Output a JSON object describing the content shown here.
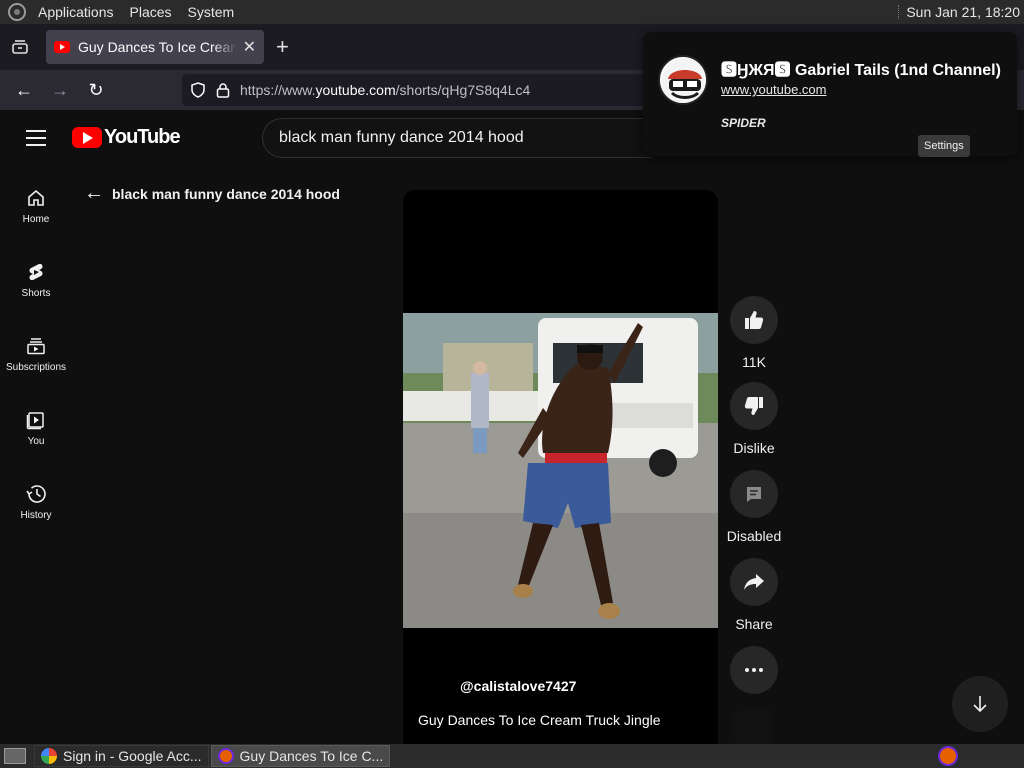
{
  "os": {
    "menus": [
      "Applications",
      "Places",
      "System"
    ],
    "clock": "Sun Jan 21, 18:20"
  },
  "browser": {
    "tab_title": "Guy Dances To Ice Cream Truck Jingle",
    "url_prefix": "https://www.",
    "url_domain": "youtube.com",
    "url_path": "/shorts/qHg7S8q4Lc4"
  },
  "youtube": {
    "logo_text": "YouTube",
    "search_query": "black man funny dance 2014 hood",
    "back_label": "black man funny dance 2014 hood",
    "sidebar": [
      {
        "label": "Home",
        "icon": "home-icon"
      },
      {
        "label": "Shorts",
        "icon": "shorts-icon"
      },
      {
        "label": "Subscriptions",
        "icon": "subscriptions-icon"
      },
      {
        "label": "You",
        "icon": "you-icon"
      },
      {
        "label": "History",
        "icon": "history-icon"
      }
    ],
    "short": {
      "channel": "@calistalove7427",
      "title": "Guy Dances To Ice Cream Truck Jingle"
    },
    "actions": {
      "like": "11K",
      "dislike": "Dislike",
      "comments": "Disabled",
      "share": "Share"
    }
  },
  "popup": {
    "title": "🆂ӇЖЯ🆂 Gabriel Tails (1nd Channel)",
    "link": "www.youtube.com",
    "tag": "SPIDER"
  },
  "tooltip": "Settings",
  "taskbar": {
    "tasks": [
      "Sign in - Google Acc...",
      "Guy Dances To Ice C..."
    ]
  },
  "colors": {
    "youtube_red": "#ff0000",
    "background": "#0f0f0f",
    "action_button": "#272727"
  }
}
